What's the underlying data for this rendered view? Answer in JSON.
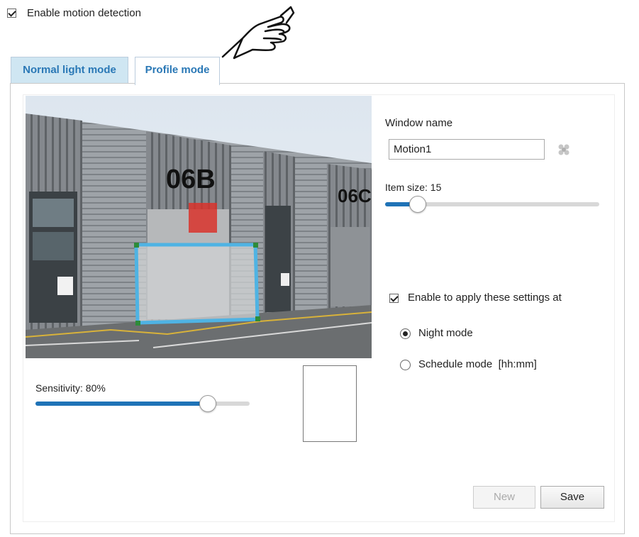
{
  "motion": {
    "enable_label": "Enable motion detection",
    "enabled": true
  },
  "tabs": [
    {
      "label": "Normal light mode",
      "active": false
    },
    {
      "label": "Profile mode",
      "active": true
    }
  ],
  "camera_view": {
    "building_labels": [
      "06B",
      "06C"
    ]
  },
  "sensitivity": {
    "label": "Sensitivity: 80%",
    "value": 80
  },
  "window_name": {
    "label": "Window name",
    "value": "Motion1"
  },
  "item_size": {
    "label": "Item size: 15",
    "value": 15,
    "max": 100
  },
  "apply_settings": {
    "label": "Enable to apply these settings at",
    "checked": true,
    "options": [
      {
        "label": "Night mode",
        "selected": true
      },
      {
        "label": "Schedule mode  [hh:mm]",
        "selected": false
      }
    ]
  },
  "buttons": {
    "new_label": "New",
    "save_label": "Save"
  },
  "colors": {
    "accent": "#1f73b7",
    "tab_inactive_bg": "#cfe6f2",
    "tab_text": "#2a78b6",
    "motion_window": "#4fb3e3",
    "alert_block": "#d9322c"
  }
}
